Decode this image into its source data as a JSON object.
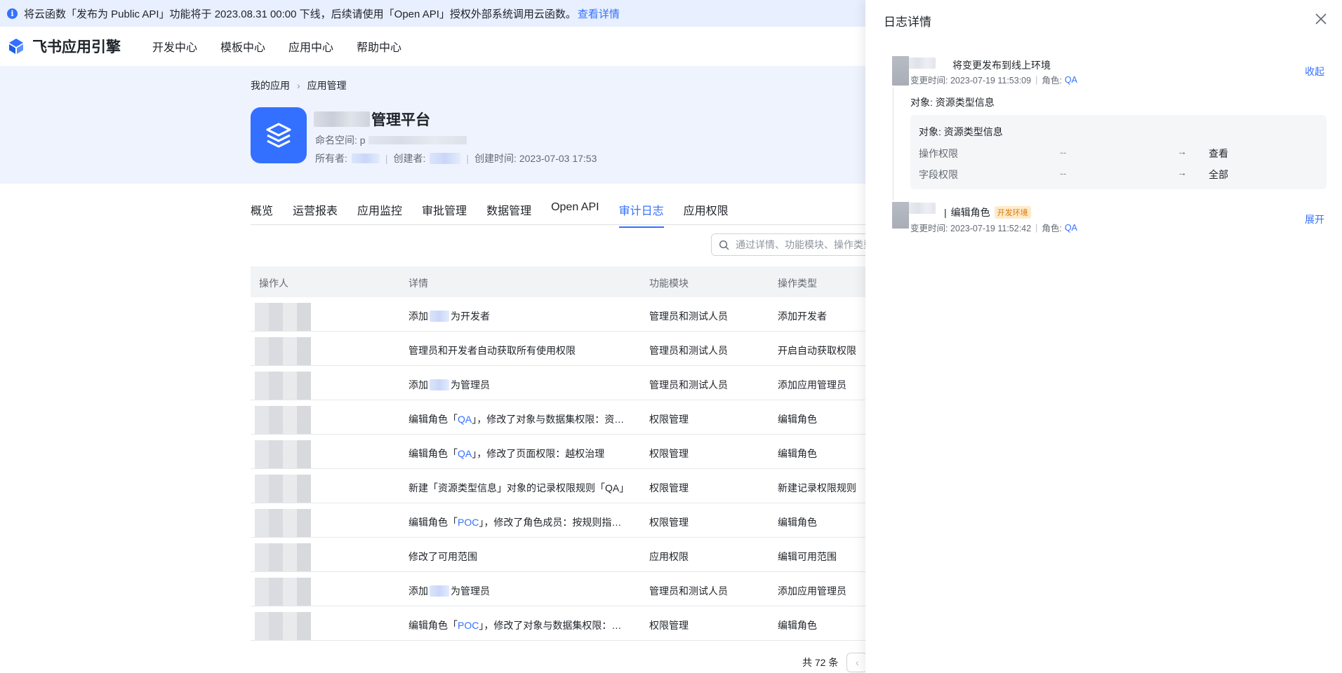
{
  "banner": {
    "text": "将云函数「发布为 Public API」功能将于 2023.08.31 00:00 下线，后续请使用「Open API」授权外部系统调用云函数。",
    "link": "查看详情"
  },
  "nav": {
    "brand": "飞书应用引擎",
    "items": [
      "开发中心",
      "模板中心",
      "应用中心",
      "帮助中心"
    ]
  },
  "breadcrumb": {
    "parent": "我的应用",
    "current": "应用管理"
  },
  "app": {
    "title_suffix": "管理平台",
    "namespace_label": "命名空间: p",
    "owner_label": "所有者:",
    "creator_label": "创建者:",
    "created_label": "创建时间: 2023-07-03 17:53"
  },
  "tabs": [
    "概览",
    "运营报表",
    "应用监控",
    "审批管理",
    "数据管理",
    "Open API",
    "审计日志",
    "应用权限"
  ],
  "search": {
    "placeholder": "通过详情、功能模块、操作类型"
  },
  "table": {
    "headers": [
      "操作人",
      "详情",
      "功能模块",
      "操作类型"
    ],
    "rows": [
      {
        "pre": "添加",
        "q": "",
        "post": "为开发者",
        "module": "管理员和测试人员",
        "type": "添加开发者"
      },
      {
        "pre": "管理员和开发者自动获取所有使用权限",
        "q": "",
        "post": "",
        "module": "管理员和测试人员",
        "type": "开启自动获取权限"
      },
      {
        "pre": "添加",
        "q": "",
        "post": "为管理员",
        "module": "管理员和测试人员",
        "type": "添加应用管理员"
      },
      {
        "pre": "编辑角色「",
        "q": "QA",
        "post": "」，修改了对象与数据集权限：资…",
        "module": "权限管理",
        "type": "编辑角色"
      },
      {
        "pre": "编辑角色「",
        "q": "QA",
        "post": "」，修改了页面权限：越权治理",
        "module": "权限管理",
        "type": "编辑角色"
      },
      {
        "pre": "新建「资源类型信息」对象的记录权限规则「QA」",
        "q": "",
        "post": "",
        "module": "权限管理",
        "type": "新建记录权限规则"
      },
      {
        "pre": "编辑角色「",
        "q": "POC",
        "post": "」，修改了角色成员：按规则指…",
        "module": "权限管理",
        "type": "编辑角色"
      },
      {
        "pre": "修改了可用范围",
        "q": "",
        "post": "",
        "module": "应用权限",
        "type": "编辑可用范围"
      },
      {
        "pre": "添加",
        "q": "",
        "post": "为管理员",
        "module": "管理员和测试人员",
        "type": "添加应用管理员"
      },
      {
        "pre": "编辑角色「",
        "q": "POC",
        "post": "」，修改了对象与数据集权限：…",
        "module": "权限管理",
        "type": "编辑角色"
      }
    ],
    "total": "共 72 条"
  },
  "drawer": {
    "title": "日志详情",
    "entries": [
      {
        "title": "将变更发布到线上环境",
        "time_label": "变更时间: 2023-07-19 11:53:09",
        "role_label": "角色:",
        "role": "QA",
        "toggle": "收起",
        "object_label": "对象: 资源类型信息",
        "detail": {
          "object": "对象: 资源类型信息",
          "rows": [
            {
              "key": "操作权限",
              "from": "--",
              "to": "查看"
            },
            {
              "key": "字段权限",
              "from": "--",
              "to": "全部"
            }
          ]
        }
      },
      {
        "title": "编辑角色",
        "tag": "开发环境",
        "time_label": "变更时间: 2023-07-19 11:52:42",
        "role_label": "角色:",
        "role": "QA",
        "toggle": "展开"
      }
    ]
  },
  "colors": {
    "accent": "#3370ff",
    "tag_text": "#de7802",
    "tag_bg": "#fdebcb"
  }
}
